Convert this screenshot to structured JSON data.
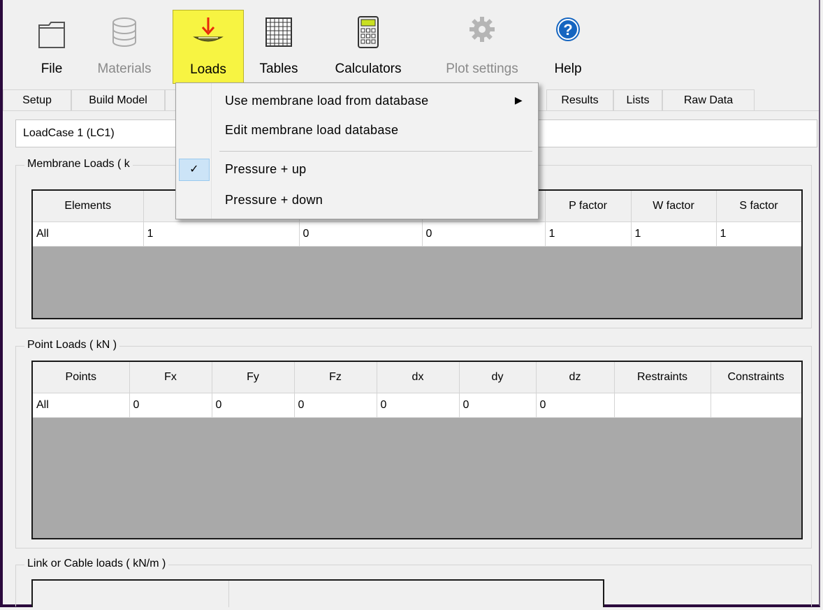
{
  "toolbar": {
    "buttons": [
      {
        "label": "File",
        "icon": "folder-icon",
        "enabled": true
      },
      {
        "label": "Materials",
        "icon": "database-icon",
        "enabled": false
      },
      {
        "label": "Loads",
        "icon": "loads-icon",
        "enabled": true,
        "active": true
      },
      {
        "label": "Tables",
        "icon": "table-grid-icon",
        "enabled": true
      },
      {
        "label": "Calculators",
        "icon": "calculator-icon",
        "enabled": true
      },
      {
        "label": "Plot settings",
        "icon": "gear-icon",
        "enabled": false
      },
      {
        "label": "Help",
        "icon": "help-icon",
        "enabled": true
      }
    ]
  },
  "tabs": [
    "Setup",
    "Build Model",
    "Results",
    "Lists",
    "Raw Data"
  ],
  "loadcase": {
    "value": "LoadCase 1   (LC1)"
  },
  "membrane": {
    "title": "Membrane Loads ( k",
    "headers": [
      "Elements",
      "",
      "",
      "",
      "P factor",
      "W factor",
      "S factor"
    ],
    "rows": [
      [
        "All",
        "1",
        "0",
        "0",
        "1",
        "1",
        "1"
      ]
    ]
  },
  "point": {
    "title": "Point Loads ( kN )",
    "headers": [
      "Points",
      "Fx",
      "Fy",
      "Fz",
      "dx",
      "dy",
      "dz",
      "Restraints",
      "Constraints"
    ],
    "rows": [
      [
        "All",
        "0",
        "0",
        "0",
        "0",
        "0",
        "0",
        "",
        ""
      ]
    ]
  },
  "link": {
    "title": "Link or Cable loads ( kN/m )"
  },
  "menu": {
    "items": [
      {
        "label": "Use membrane load from database",
        "submenu": true
      },
      {
        "label": "Edit membrane load database"
      },
      {
        "label": "Pressure + up",
        "checked": true
      },
      {
        "label": "Pressure + down"
      }
    ]
  },
  "colors": {
    "active_button": "#f7f442",
    "grid_empty": "#a9a9a9",
    "menu_check": "#cce4f7",
    "loads_arrow": "#e8290b"
  }
}
